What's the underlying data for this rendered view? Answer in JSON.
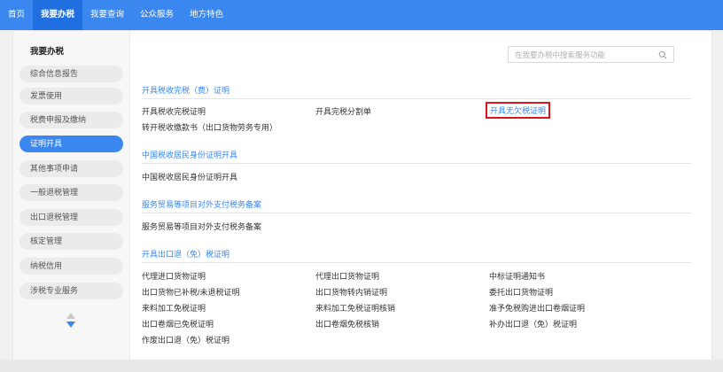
{
  "topnav": {
    "items": [
      "首页",
      "我要办税",
      "我要查询",
      "公众服务",
      "地方特色"
    ]
  },
  "sidebar": {
    "title": "我要办税",
    "items": [
      "综合信息报告",
      "发票使用",
      "税费申报及缴纳",
      "证明开具",
      "其他事项申请",
      "一般退税管理",
      "出口退税管理",
      "核定管理",
      "纳税信用",
      "涉税专业服务"
    ]
  },
  "search": {
    "placeholder": "在我要办税中搜索服务功能"
  },
  "sections": [
    {
      "title": "开具税收完税（费）证明",
      "links": [
        "开具税收完税证明",
        "开具完税分割单",
        "开具无欠税证明",
        "转开税收缴款书（出口货物劳务专用）"
      ]
    },
    {
      "title": "中国税收居民身份证明开具",
      "links": [
        "中国税收居民身份证明开具"
      ]
    },
    {
      "title": "服务贸易等项目对外支付税务备案",
      "links": [
        "服务贸易等项目对外支付税务备案"
      ]
    },
    {
      "title": "开具出口退（免）税证明",
      "links": [
        "代理进口货物证明",
        "代理出口货物证明",
        "中标证明通知书",
        "出口货物已补税/未退税证明",
        "出口货物转内销证明",
        "委托出口货物证明",
        "来料加工免税证明",
        "来料加工免税证明核销",
        "准予免税购进出口卷烟证明",
        "出口卷烟已免税证明",
        "出口卷烟免税核销",
        "补办出口退（免）税证明",
        "作废出口退（免）税证明"
      ]
    }
  ],
  "colors": {
    "primary": "#3a87f0",
    "active_nav": "#1f6fe0",
    "highlight_border": "#e0141b"
  }
}
